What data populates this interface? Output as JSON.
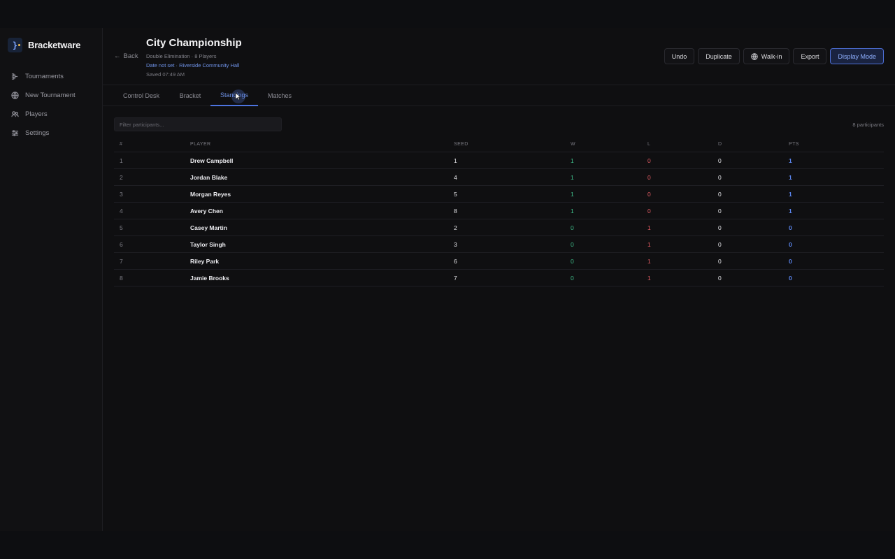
{
  "brand": {
    "name": "Bracketware",
    "logo_glyph": "}"
  },
  "sidebar": {
    "items": [
      {
        "label": "Tournaments",
        "icon": "tournaments-icon"
      },
      {
        "label": "New Tournament",
        "icon": "globe-icon"
      },
      {
        "label": "Players",
        "icon": "users-icon"
      },
      {
        "label": "Settings",
        "icon": "sliders-icon"
      }
    ]
  },
  "header": {
    "back_label": "Back",
    "title": "City Championship",
    "subtitle": "Double Elimination · 8 Players",
    "meta": "Date not set · Riverside Community Hall",
    "saved": "Saved 07:49 AM"
  },
  "actions": {
    "undo": "Undo",
    "duplicate": "Duplicate",
    "walkin": "Walk-in",
    "export": "Export",
    "display_mode": "Display Mode"
  },
  "tabs": {
    "control_desk": "Control Desk",
    "bracket": "Bracket",
    "standings": "Standings",
    "matches": "Matches",
    "active": "Standings"
  },
  "standings": {
    "filter_placeholder": "Filter participants...",
    "count": "8 participants",
    "columns": {
      "rank": "#",
      "player": "PLAYER",
      "seed": "SEED",
      "w": "W",
      "l": "L",
      "d": "D",
      "pts": "PTS"
    },
    "rows": [
      {
        "rank": "1",
        "player": "Drew Campbell",
        "seed": "1",
        "w": "1",
        "l": "0",
        "d": "0",
        "pts": "1"
      },
      {
        "rank": "2",
        "player": "Jordan Blake",
        "seed": "4",
        "w": "1",
        "l": "0",
        "d": "0",
        "pts": "1"
      },
      {
        "rank": "3",
        "player": "Morgan Reyes",
        "seed": "5",
        "w": "1",
        "l": "0",
        "d": "0",
        "pts": "1"
      },
      {
        "rank": "4",
        "player": "Avery Chen",
        "seed": "8",
        "w": "1",
        "l": "0",
        "d": "0",
        "pts": "1"
      },
      {
        "rank": "5",
        "player": "Casey Martin",
        "seed": "2",
        "w": "0",
        "l": "1",
        "d": "0",
        "pts": "0"
      },
      {
        "rank": "6",
        "player": "Taylor Singh",
        "seed": "3",
        "w": "0",
        "l": "1",
        "d": "0",
        "pts": "0"
      },
      {
        "rank": "7",
        "player": "Riley Park",
        "seed": "6",
        "w": "0",
        "l": "1",
        "d": "0",
        "pts": "0"
      },
      {
        "rank": "8",
        "player": "Jamie Brooks",
        "seed": "7",
        "w": "0",
        "l": "1",
        "d": "0",
        "pts": "0"
      }
    ]
  },
  "colors": {
    "accent": "#4d74e0",
    "win": "#3fbf8a",
    "loss": "#e25c63",
    "points": "#5b86f0"
  }
}
